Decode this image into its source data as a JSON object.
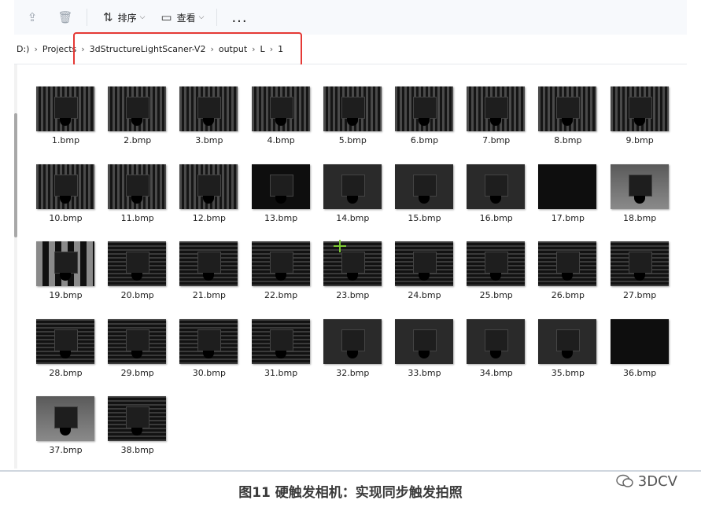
{
  "toolbar": {
    "sort_label": "排序",
    "view_label": "查看",
    "more_label": "..."
  },
  "breadcrumb": [
    "D:)",
    "Projects",
    "3dStructureLightScaner-V2",
    "output",
    "L",
    "1"
  ],
  "files": [
    "1.bmp",
    "2.bmp",
    "3.bmp",
    "4.bmp",
    "5.bmp",
    "6.bmp",
    "7.bmp",
    "8.bmp",
    "9.bmp",
    "10.bmp",
    "11.bmp",
    "12.bmp",
    "13.bmp",
    "14.bmp",
    "15.bmp",
    "16.bmp",
    "17.bmp",
    "18.bmp",
    "19.bmp",
    "20.bmp",
    "21.bmp",
    "22.bmp",
    "23.bmp",
    "24.bmp",
    "25.bmp",
    "26.bmp",
    "27.bmp",
    "28.bmp",
    "29.bmp",
    "30.bmp",
    "31.bmp",
    "32.bmp",
    "33.bmp",
    "34.bmp",
    "35.bmp",
    "36.bmp",
    "37.bmp",
    "38.bmp"
  ],
  "caption": "图11 硬触发相机：实现同步触发拍照",
  "watermark": "3DCV",
  "colors": {
    "highlight_box": "#e53935",
    "cursor": "#7cc934"
  }
}
